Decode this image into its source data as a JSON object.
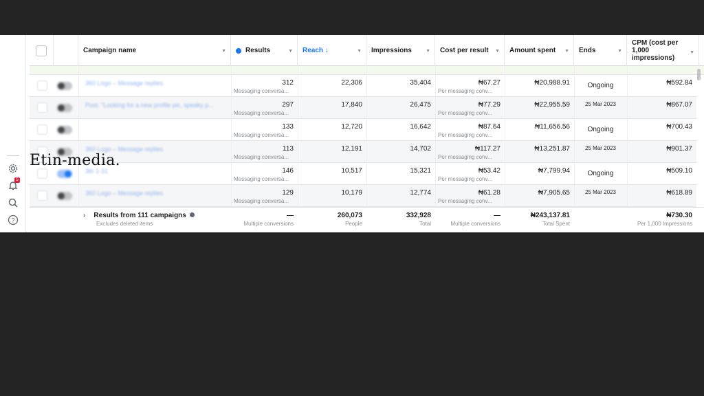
{
  "watermark": "Etin-media.",
  "columns": {
    "campaign_name": "Campaign name",
    "results": "Results",
    "reach": "Reach ↓",
    "impressions": "Impressions",
    "cost_per_result": "Cost per result",
    "amount_spent": "Amount spent",
    "ends": "Ends",
    "cpm": "CPM (cost per 1,000 impressions)"
  },
  "sidebar": {
    "notification_count": "5",
    "icons": [
      "gear-icon",
      "bell-icon",
      "search-icon",
      "help-icon"
    ]
  },
  "rows": [
    {
      "name": "360 Logo – Message replies",
      "toggle_on": false,
      "results": "312",
      "results_sub": "Messaging conversa...",
      "reach": "22,306",
      "impressions": "35,404",
      "cpr": "₦67.27",
      "cpr_sub": "Per messaging conv...",
      "spent": "₦20,988.91",
      "ends": "Ongoing",
      "cpm": "₦592.84"
    },
    {
      "name": "Post: \"Looking for a new profile pic, speaky p...",
      "toggle_on": false,
      "results": "297",
      "results_sub": "Messaging conversa...",
      "reach": "17,840",
      "impressions": "26,475",
      "cpr": "₦77.29",
      "cpr_sub": "Per messaging conv...",
      "spent": "₦22,955.59",
      "ends": "25 Mar 2023",
      "cpm": "₦867.07"
    },
    {
      "name": "",
      "toggle_on": false,
      "results": "133",
      "results_sub": "Messaging conversa...",
      "reach": "12,720",
      "impressions": "16,642",
      "cpr": "₦87.64",
      "cpr_sub": "Per messaging conv...",
      "spent": "₦11,656.56",
      "ends": "Ongoing",
      "cpm": "₦700.43"
    },
    {
      "name": "360 Logo – Message replies",
      "toggle_on": false,
      "results": "113",
      "results_sub": "Messaging conversa...",
      "reach": "12,191",
      "impressions": "14,702",
      "cpr": "₦117.27",
      "cpr_sub": "Per messaging conv...",
      "spent": "₦13,251.87",
      "ends": "25 Mar 2023",
      "cpm": "₦901.37"
    },
    {
      "name": "3th 1-31",
      "toggle_on": true,
      "results": "146",
      "results_sub": "Messaging conversa...",
      "reach": "10,517",
      "impressions": "15,321",
      "cpr": "₦53.42",
      "cpr_sub": "Per messaging conv...",
      "spent": "₦7,799.94",
      "ends": "Ongoing",
      "cpm": "₦509.10"
    },
    {
      "name": "360 Logo – Message replies",
      "toggle_on": false,
      "results": "129",
      "results_sub": "Messaging conversa...",
      "reach": "10,179",
      "impressions": "12,774",
      "cpr": "₦61.28",
      "cpr_sub": "Per messaging conv...",
      "spent": "₦7,905.65",
      "ends": "25 Mar 2023",
      "cpm": "₦618.89"
    }
  ],
  "summary": {
    "label": "Results from 111 campaigns",
    "sub": "Excludes deleted items",
    "results": "—",
    "results_sub": "Multiple conversions",
    "reach": "260,073",
    "reach_sub": "People",
    "impressions": "332,928",
    "impressions_sub": "Total",
    "cpr": "—",
    "cpr_sub": "Multiple conversions",
    "spent": "₦243,137.81",
    "spent_sub": "Total Spent",
    "cpm": "₦730.30",
    "cpm_sub": "Per 1,000 Impressions"
  }
}
